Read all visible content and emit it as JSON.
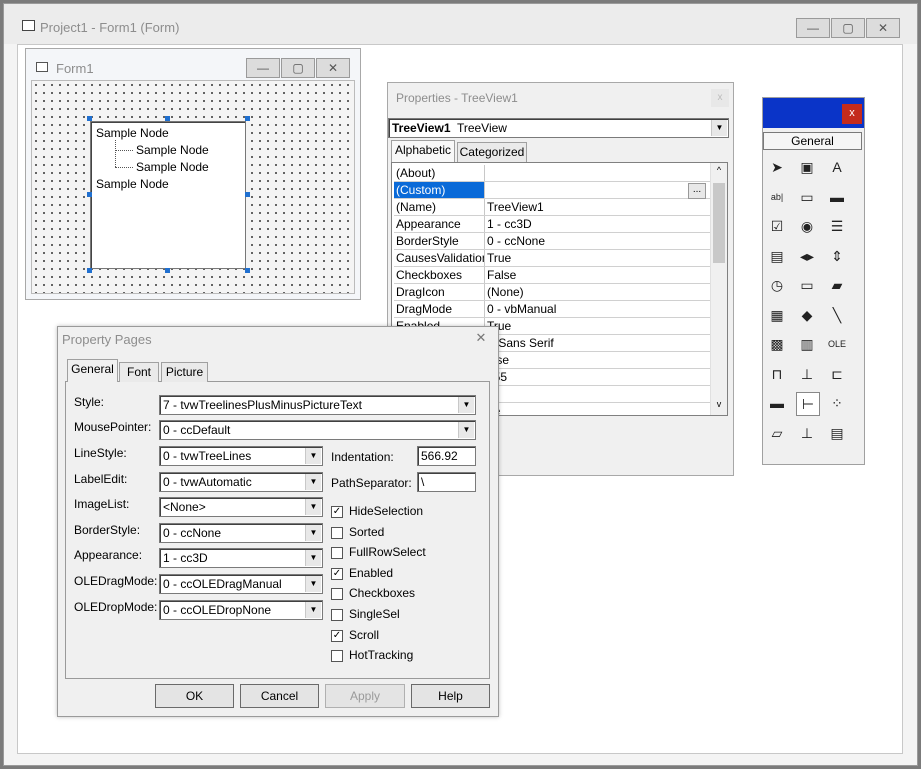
{
  "project_window": {
    "title": "Project1 - Form1 (Form)",
    "controls": [
      "―",
      "▢",
      "✕"
    ]
  },
  "form1": {
    "title": "Form1",
    "controls": [
      "―",
      "▢",
      "✕"
    ],
    "tree_nodes": [
      "Sample Node",
      "Sample Node",
      "Sample Node",
      "Sample Node"
    ]
  },
  "properties": {
    "title": "Properties - TreeView1",
    "object_name": "TreeView1",
    "object_type": "TreeView",
    "tabs": [
      "Alphabetic",
      "Categorized"
    ],
    "rows": [
      {
        "key": "(About)",
        "value": ""
      },
      {
        "key": "(Custom)",
        "value": ""
      },
      {
        "key": "(Name)",
        "value": "TreeView1"
      },
      {
        "key": "Appearance",
        "value": "1 - cc3D"
      },
      {
        "key": "BorderStyle",
        "value": "0 - ccNone"
      },
      {
        "key": "CausesValidation",
        "value": "True"
      },
      {
        "key": "Checkboxes",
        "value": "False"
      },
      {
        "key": "DragIcon",
        "value": "(None)"
      },
      {
        "key": "DragMode",
        "value": "0 - vbManual"
      },
      {
        "key": "Enabled",
        "value": "True"
      },
      {
        "key": "",
        "value": "S Sans Serif"
      },
      {
        "key": "",
        "value": "alse"
      },
      {
        "key": "",
        "value": "055"
      },
      {
        "key": "",
        "value": ""
      },
      {
        "key": "",
        "value": "ue"
      }
    ],
    "ellipsis": "..."
  },
  "toolbox": {
    "title": "General",
    "close": "x",
    "tools": [
      "pointer-icon",
      "picturebox-icon",
      "label-icon",
      "textbox-icon",
      "frame-icon",
      "commandbutton-icon",
      "checkbox-icon",
      "optionbutton-icon",
      "combobox-icon",
      "listbox-icon",
      "hscrollbar-icon",
      "vscrollbar-icon",
      "timer-icon",
      "drivelistbox-icon",
      "dirlistbox-icon",
      "filelistbox-icon",
      "shape-icon",
      "line-icon",
      "image-icon",
      "data-icon",
      "ole-icon",
      "tabstrip-icon",
      "toolbar-icon",
      "statusbar-icon",
      "progressbar-icon",
      "treeview-icon",
      "listview-icon",
      "imagelist-icon",
      "slider-icon",
      "imagecombo-icon"
    ]
  },
  "property_pages": {
    "title": "Property Pages",
    "close": "✕",
    "tabs": [
      "General",
      "Font",
      "Picture"
    ],
    "fields": {
      "style_label": "Style:",
      "style_value": "7 - tvwTreelinesPlusMinusPictureText",
      "mousepointer_label": "MousePointer:",
      "mousepointer_value": "0 - ccDefault",
      "linestyle_label": "LineStyle:",
      "linestyle_value": "0 - tvwTreeLines",
      "labeledit_label": "LabelEdit:",
      "labeledit_value": "0 - tvwAutomatic",
      "imagelist_label": "ImageList:",
      "imagelist_value": "<None>",
      "borderstyle_label": "BorderStyle:",
      "borderstyle_value": "0 - ccNone",
      "appearance_label": "Appearance:",
      "appearance_value": "1 - cc3D",
      "oledragmode_label": "OLEDragMode:",
      "oledragmode_value": "0 - ccOLEDragManual",
      "oledropmode_label": "OLEDropMode:",
      "oledropmode_value": "0 - ccOLEDropNone",
      "indentation_label": "Indentation:",
      "indentation_value": "566.92",
      "pathseparator_label": "PathSeparator:",
      "pathseparator_value": "\\"
    },
    "checkboxes": [
      {
        "label": "HideSelection",
        "checked": true
      },
      {
        "label": "Sorted",
        "checked": false
      },
      {
        "label": "FullRowSelect",
        "checked": false
      },
      {
        "label": "Enabled",
        "checked": true
      },
      {
        "label": "Checkboxes",
        "checked": false
      },
      {
        "label": "SingleSel",
        "checked": false
      },
      {
        "label": "Scroll",
        "checked": true
      },
      {
        "label": "HotTracking",
        "checked": false
      }
    ],
    "buttons": {
      "ok": "OK",
      "cancel": "Cancel",
      "apply": "Apply",
      "help": "Help"
    }
  }
}
